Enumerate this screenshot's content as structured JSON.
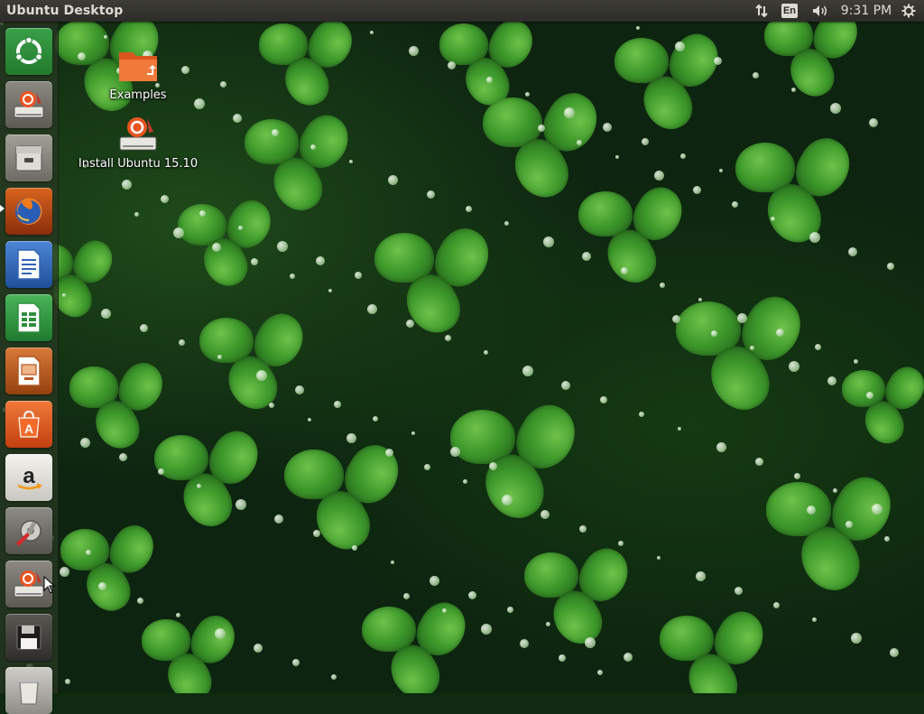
{
  "top_panel": {
    "title": "Ubuntu Desktop",
    "keyboard_layout": "En",
    "clock": "9:31 PM"
  },
  "desktop_icons": [
    {
      "label": "Examples",
      "icon": "folder-icon"
    },
    {
      "label": "Install Ubuntu 15.10",
      "icon": "ubuntu-installer-icon"
    }
  ],
  "launcher": {
    "items": [
      {
        "name": "dash-home",
        "icon": "ubuntu-logo-icon",
        "color": "#2f8f3a"
      },
      {
        "name": "install-ubuntu",
        "icon": "ubuntu-installer-icon",
        "color": "#6d6a63"
      },
      {
        "name": "files",
        "icon": "file-cabinet-icon",
        "color": "#7a776f"
      },
      {
        "name": "firefox",
        "icon": "firefox-icon",
        "color": "#b5460f",
        "running": true
      },
      {
        "name": "libreoffice-writer",
        "icon": "writer-document-icon",
        "color": "#2f65b4"
      },
      {
        "name": "libreoffice-calc",
        "icon": "calc-spreadsheet-icon",
        "color": "#2e8f3e"
      },
      {
        "name": "libreoffice-impress",
        "icon": "impress-presentation-icon",
        "color": "#b4561f"
      },
      {
        "name": "software-center",
        "icon": "shopping-bag-icon",
        "color": "#d9541d"
      },
      {
        "name": "amazon",
        "icon": "amazon-icon",
        "color": "#d8d6d0"
      },
      {
        "name": "system-settings",
        "icon": "settings-wrench-icon",
        "color": "#6a6862"
      },
      {
        "name": "install-ubuntu-running",
        "icon": "ubuntu-installer-icon",
        "color": "#6d6a63"
      },
      {
        "name": "device",
        "icon": "floppy-disk-icon",
        "color": "#46443f"
      },
      {
        "name": "trash",
        "icon": "trash-icon",
        "color": "#8a8882"
      }
    ]
  }
}
